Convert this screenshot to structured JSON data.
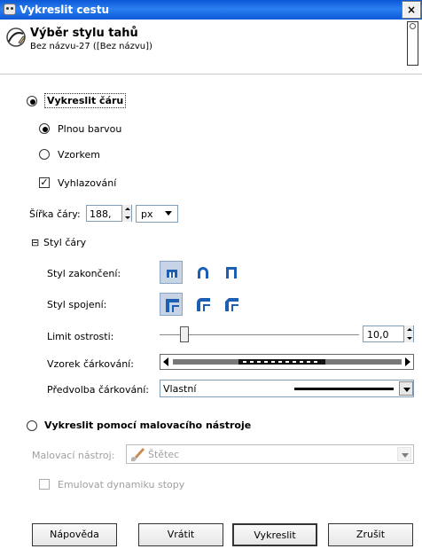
{
  "window": {
    "title": "Vykreslit cestu",
    "close_label": "×"
  },
  "header": {
    "title": "Výběr stylu tahů",
    "subtitle": "Bez názvu-27 ([Bez názvu])"
  },
  "stroke_line": {
    "label": "Vykreslit čáru",
    "selected": true,
    "fill_solid_label": "Plnou barvou",
    "fill_pattern_label": "Vzorkem",
    "fill_selected": "solid",
    "antialias_label": "Vyhlazování",
    "antialias_checked": true,
    "antialias_mark": "✓",
    "width_label": "Šířka čáry:",
    "width_value": "188,",
    "width_unit": "px",
    "line_style_label": "Styl čáry",
    "expander_symbol": "⊟",
    "cap_label": "Styl zakončení:",
    "join_label": "Styl spojení:",
    "miter_label": "Limit ostrosti:",
    "miter_value": "10,0",
    "miter_level": 0.1,
    "dash_pattern_label": "Vzorek čárkování:",
    "dash_preset_label": "Předvolba čárkování:",
    "dash_preset_value": "Vlastní"
  },
  "paint_tool": {
    "label": "Vykreslit pomocí malovacího nástroje",
    "selected": false,
    "tool_label": "Malovací nástroj:",
    "tool_value": "Štětec",
    "emulate_label": "Emulovat dynamiku stopy",
    "emulate_checked": false
  },
  "buttons": {
    "help": "Nápověda",
    "reset": "Vrátit",
    "stroke": "Vykreslit",
    "cancel": "Zrušit"
  },
  "colors": {
    "titlebar": "#0a57d6",
    "accent_blue": "#1c5fb3",
    "disabled_text": "#a0a0a0"
  }
}
